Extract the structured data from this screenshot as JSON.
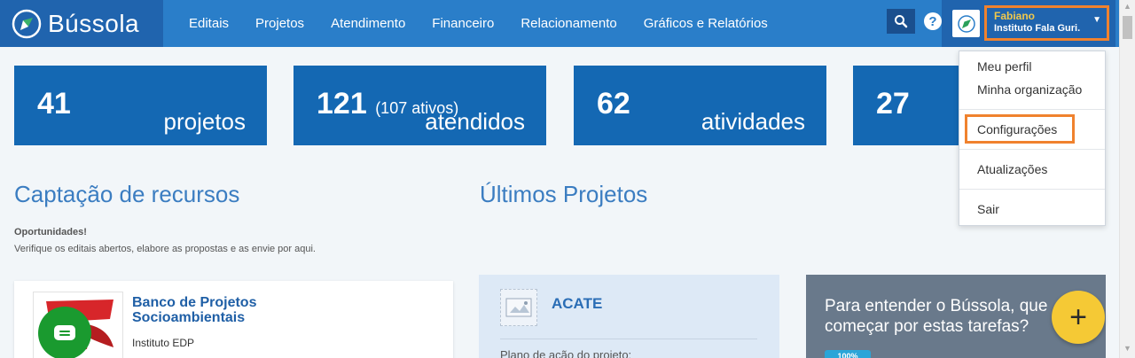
{
  "brand": {
    "name": "Bússola"
  },
  "nav": [
    {
      "label": "Editais"
    },
    {
      "label": "Projetos"
    },
    {
      "label": "Atendimento"
    },
    {
      "label": "Financeiro"
    },
    {
      "label": "Relacionamento"
    },
    {
      "label": "Gráficos e Relatórios"
    }
  ],
  "help": {
    "glyph": "?"
  },
  "user": {
    "name": "Fabiano",
    "org": "Instituto Fala Guri."
  },
  "stats": [
    {
      "number": "41",
      "sub": "",
      "label": "projetos"
    },
    {
      "number": "121",
      "sub": "(107 ativos)",
      "label": "atendidos"
    },
    {
      "number": "62",
      "sub": "",
      "label": "atividades"
    },
    {
      "number": "27",
      "sub": "",
      "label": ""
    }
  ],
  "captacao": {
    "heading": "Captação de recursos",
    "opp_title": "Oportunidades!",
    "opp_desc": "Verifique os editais abertos, elabore as propostas e as envie por aqui.",
    "card": {
      "title": "Banco de Projetos Socioambientais",
      "org": "Instituto EDP"
    }
  },
  "projetos": {
    "heading": "Últimos Projetos",
    "card": {
      "name": "ACATE",
      "plan": "Plano de ação do projeto:"
    }
  },
  "tasks": {
    "text_line1": "Para entender o Bússola, que",
    "text_line2": "começar por estas tarefas?",
    "badge": "100%"
  },
  "dropdown": {
    "items": [
      {
        "label": "Meu perfil"
      },
      {
        "label": "Minha organização"
      },
      {
        "label": "Configurações"
      },
      {
        "label": "Atualizações"
      },
      {
        "label": "Sair"
      }
    ]
  },
  "fab": {
    "add": "+"
  },
  "colors": {
    "brand_blue": "#2a7ec9",
    "card_blue": "#1468b3",
    "accent_orange": "#f0822e",
    "fab_yellow": "#f5c935",
    "chat_green": "#1a9a2f"
  }
}
